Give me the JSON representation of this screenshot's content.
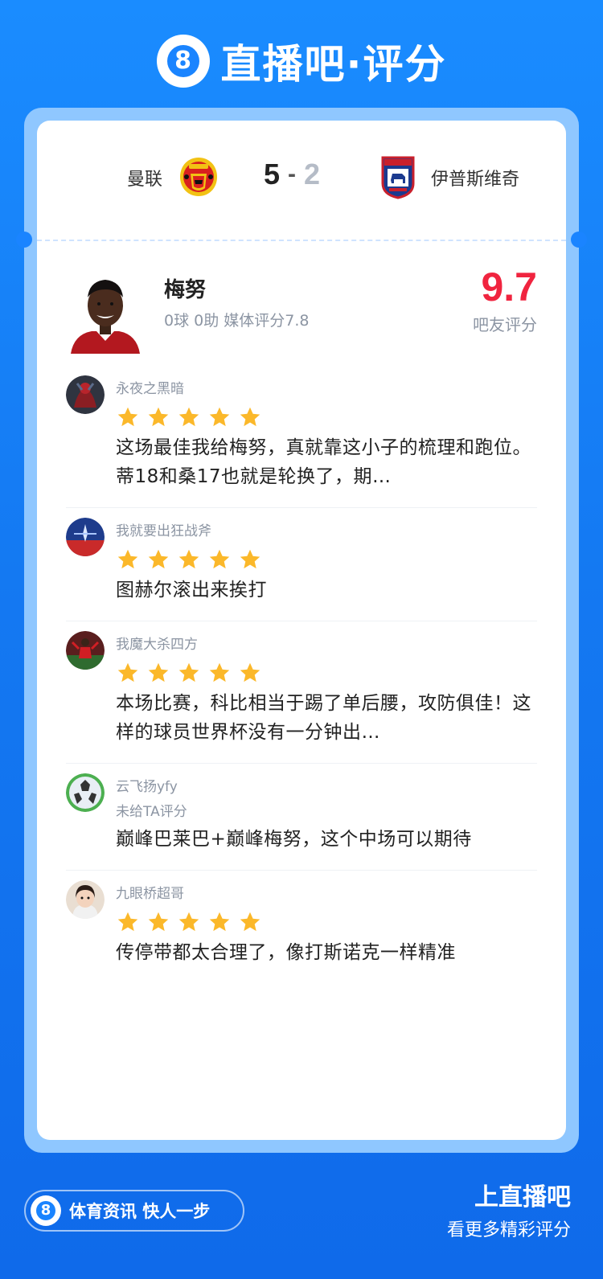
{
  "brand": {
    "logo_char": "8",
    "title": "直播吧·评分"
  },
  "match": {
    "home_team": "曼联",
    "away_team": "伊普斯维奇",
    "home_score": "5",
    "separator": "-",
    "away_score": "2"
  },
  "player": {
    "name": "梅努",
    "stats": "0球 0助 媒体评分7.8",
    "fan_score": "9.7",
    "fan_score_label": "吧友评分"
  },
  "comments": [
    {
      "username": "永夜之黑暗",
      "stars": 5,
      "text": "这场最佳我给梅努，真就靠这小子的梳理和跑位。蒂18和桑17也就是轮换了，期…"
    },
    {
      "username": "我就要出狂战斧",
      "stars": 5,
      "text": "图赫尔滚出来挨打"
    },
    {
      "username": "我魔大杀四方",
      "stars": 5,
      "text": "本场比赛，科比相当于踢了单后腰，攻防俱佳！这样的球员世界杯没有一分钟出…"
    },
    {
      "username": "云飞扬yfy",
      "stars": 0,
      "no_rating": "未给TA评分",
      "text": "巅峰巴莱巴+巅峰梅努，这个中场可以期待"
    },
    {
      "username": "九眼桥超哥",
      "stars": 5,
      "text": "传停带都太合理了，像打斯诺克一样精准"
    }
  ],
  "footer": {
    "logo_char": "8",
    "slogan": "体育资讯 快人一步",
    "title": "上直播吧",
    "subtitle": "看更多精彩评分"
  },
  "colors": {
    "background": "#1a84ff",
    "frame": "#8fc7ff",
    "score_red": "#f0243f",
    "star": "#fbb82a",
    "muted": "#8c95a3"
  },
  "icons": {
    "home_crest": "manchester-united-crest-icon",
    "away_crest": "ipswich-town-crest-icon",
    "star": "star-icon"
  }
}
